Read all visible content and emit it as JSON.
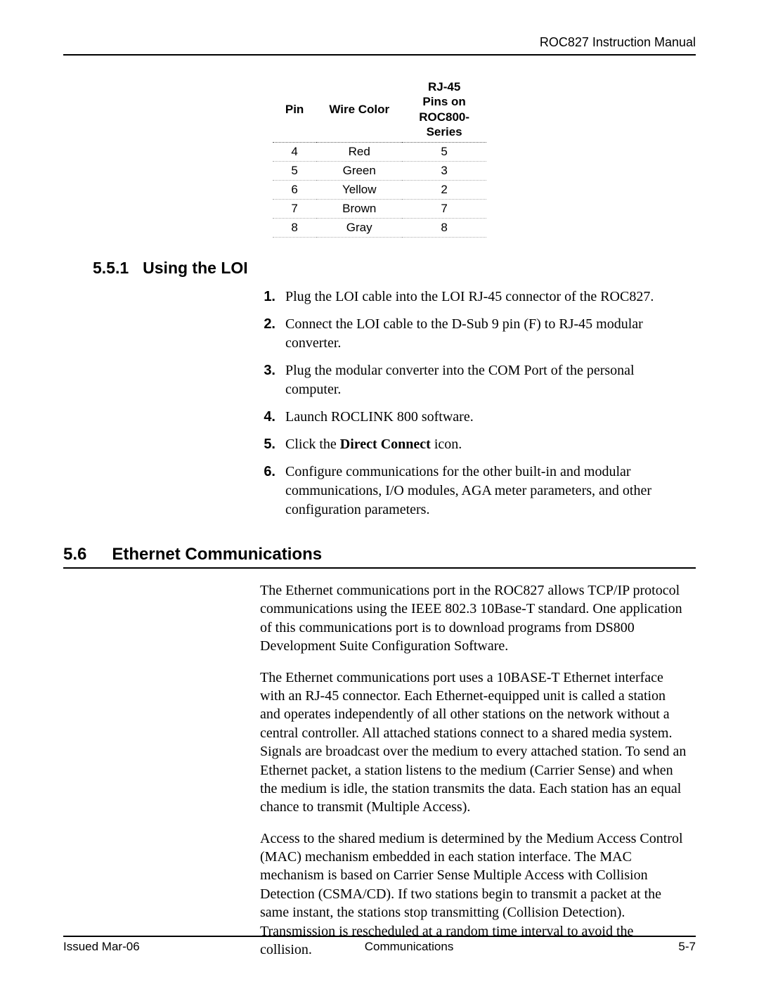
{
  "header": {
    "title": "ROC827 Instruction Manual"
  },
  "table": {
    "headers": {
      "pin": "Pin",
      "wire": "Wire Color",
      "rj45": "RJ-45 Pins on ROC800-Series"
    },
    "rows": [
      {
        "pin": "4",
        "wire": "Red",
        "rj45": "5"
      },
      {
        "pin": "5",
        "wire": "Green",
        "rj45": "3"
      },
      {
        "pin": "6",
        "wire": "Yellow",
        "rj45": "2"
      },
      {
        "pin": "7",
        "wire": "Brown",
        "rj45": "7"
      },
      {
        "pin": "8",
        "wire": "Gray",
        "rj45": "8"
      }
    ]
  },
  "sec551": {
    "number": "5.5.1",
    "title": "Using the LOI",
    "steps": [
      {
        "n": "1.",
        "pre": "Plug the LOI cable into the LOI RJ-45 connector of the ROC827.",
        "bold": "",
        "post": ""
      },
      {
        "n": "2.",
        "pre": "Connect the LOI cable to the D-Sub 9 pin (F) to RJ-45 modular converter.",
        "bold": "",
        "post": ""
      },
      {
        "n": "3.",
        "pre": "Plug the modular converter into the COM Port of the personal computer.",
        "bold": "",
        "post": ""
      },
      {
        "n": "4.",
        "pre": "Launch ROCLINK 800 software.",
        "bold": "",
        "post": ""
      },
      {
        "n": "5.",
        "pre": "Click the ",
        "bold": "Direct Connect",
        "post": " icon."
      },
      {
        "n": "6.",
        "pre": "Configure communications for the other built-in and modular communications, I/O modules, AGA meter parameters, and other configuration parameters.",
        "bold": "",
        "post": ""
      }
    ]
  },
  "sec56": {
    "number": "5.6",
    "title": "Ethernet Communications",
    "paragraphs": [
      "The Ethernet communications port in the ROC827 allows TCP/IP protocol communications using the IEEE 802.3 10Base-T standard. One application of this communications port is to download programs from DS800 Development Suite Configuration Software.",
      "The Ethernet communications port uses a 10BASE-T Ethernet interface with an RJ-45 connector. Each Ethernet-equipped unit is called a station and operates independently of all other stations on the network without a central controller. All attached stations connect to a shared media system. Signals are broadcast over the medium to every attached station. To send an Ethernet packet, a station listens to the medium (Carrier Sense) and when the medium is idle, the station transmits the data. Each station has an equal chance to transmit (Multiple Access).",
      "Access to the shared medium is determined by the Medium Access Control (MAC) mechanism embedded in each station interface. The MAC mechanism is based on Carrier Sense Multiple Access with Collision Detection (CSMA/CD). If two stations begin to transmit a packet at the same instant, the stations stop transmitting (Collision Detection). Transmission is rescheduled at a random time interval to avoid the collision."
    ]
  },
  "footer": {
    "left": "Issued Mar-06",
    "center": "Communications",
    "right": "5-7"
  }
}
